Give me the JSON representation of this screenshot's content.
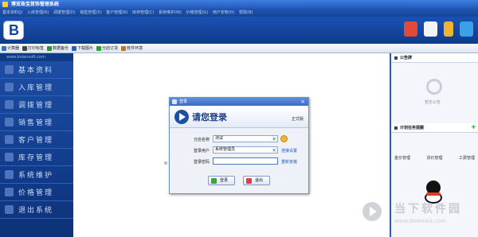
{
  "window": {
    "title": "博览珠宝首饰管理系统"
  },
  "menu": [
    "基本资料(J)",
    "入库管理(R)",
    "调拨管理(D)",
    "销售管理(X)",
    "客户管理(K)",
    "库存管理(C)",
    "系统维护(W)",
    "价格管理(G)",
    "用户安帐(H)",
    "帮助(B)"
  ],
  "banner_icons": [
    "user-card-icon",
    "mail-icon",
    "key-icon",
    "switch-arrow-icon"
  ],
  "toolbar": [
    {
      "label": "计算器",
      "icon": "calculator-icon",
      "color": "#3a6fc8"
    },
    {
      "label": "打印标签",
      "icon": "barcode-icon",
      "color": "#444444"
    },
    {
      "label": "数据备份",
      "icon": "database-icon",
      "color": "#2f8f3a"
    },
    {
      "label": "下载图片",
      "icon": "download-icon",
      "color": "#2a5fb8"
    },
    {
      "label": "分店订货",
      "icon": "plus-icon",
      "color": "#2aa02a"
    },
    {
      "label": "软件环境",
      "icon": "pen-icon",
      "color": "#b5772a"
    }
  ],
  "sidebar": {
    "site": "www.bolansoft.com",
    "items": [
      "基本资料",
      "入库管理",
      "调拨管理",
      "销售管理",
      "客户管理",
      "库存管理",
      "系统维护",
      "价格管理",
      "退出系统"
    ]
  },
  "right_panel": {
    "bulletin_title": "公告牌",
    "bulletin_empty": "暂无公告",
    "tasks_title": "计划任务提醒",
    "tabs": [
      "金价管理",
      "货价管理",
      "工费管理"
    ]
  },
  "watermark": {
    "title": "当下软件园",
    "url": "www.downxia.com"
  },
  "login": {
    "window_title": "登录",
    "heading": "请您登录",
    "edition": "正式版",
    "branch_label": "分店名称",
    "branch_value": "测试",
    "user_label": "登录用户",
    "user_value": "系统管理员",
    "password_label": "登录密码",
    "password_value": "",
    "link_settings": "连接设置",
    "link_reinstall": "重新安装",
    "ok_label": "登录",
    "cancel_label": "退出"
  },
  "colors": {
    "accent": "#1a52b3",
    "sidebar": "#123d8c",
    "panel_border": "#2d5cb8"
  }
}
